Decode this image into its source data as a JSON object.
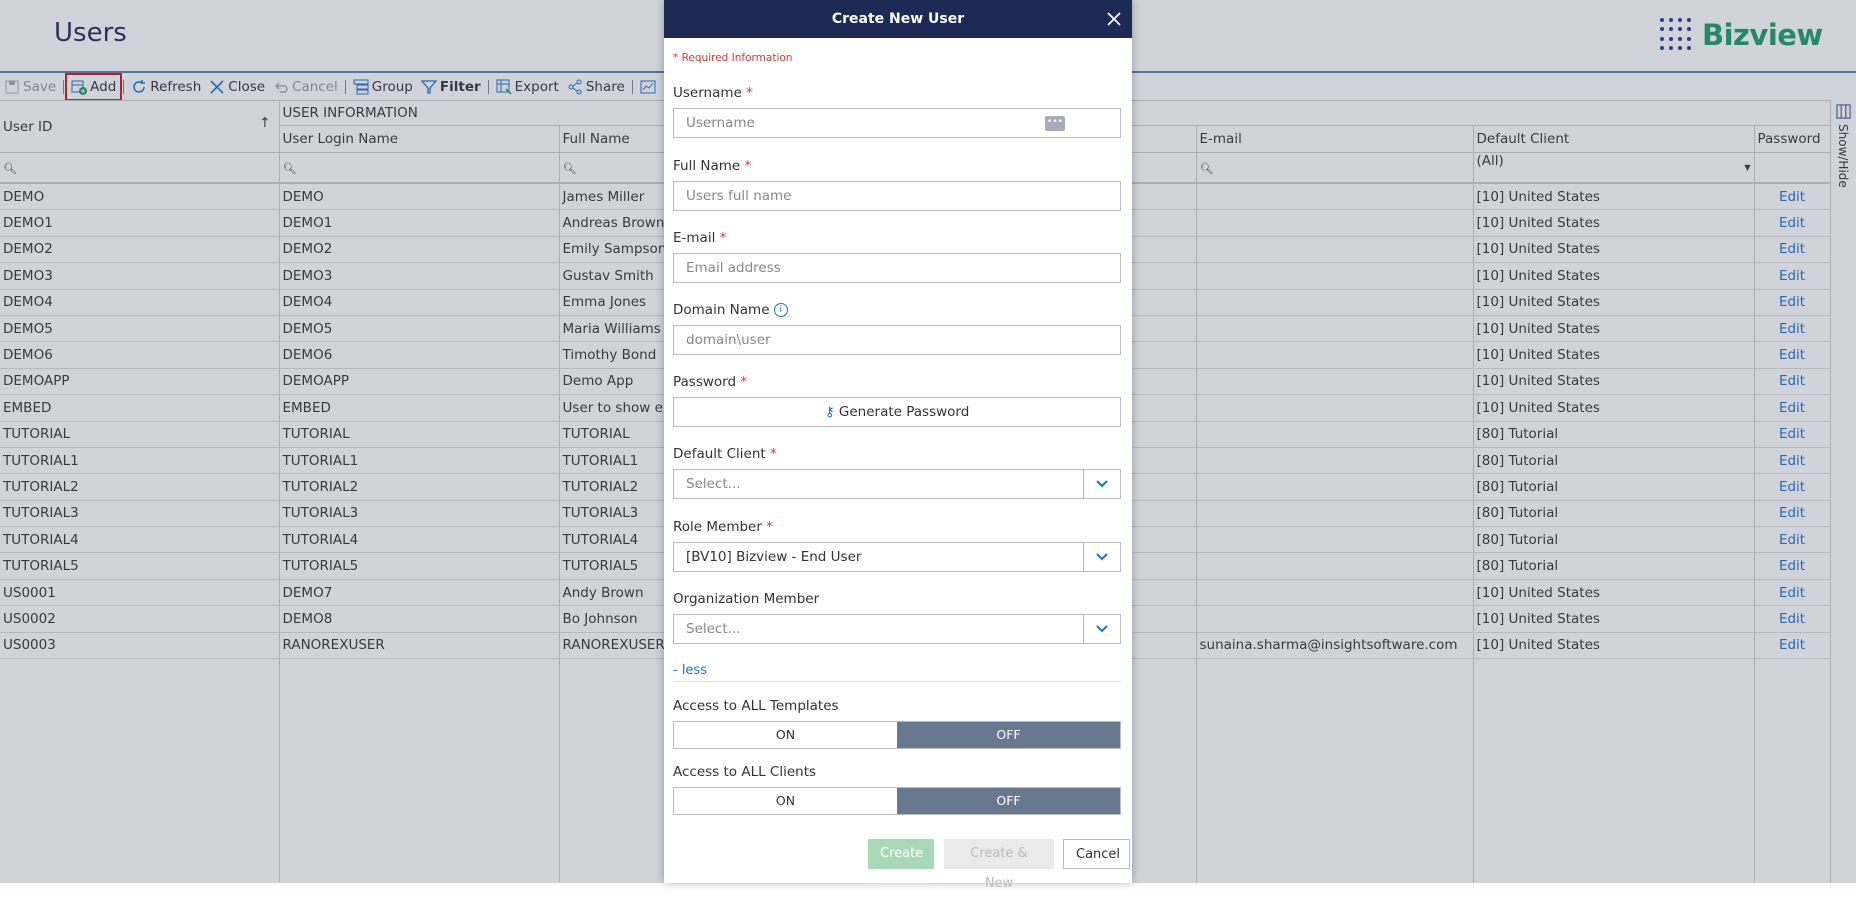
{
  "header": {
    "title": "Users",
    "logo_text": "Bizview"
  },
  "toolbar": {
    "save": "Save",
    "add": "Add",
    "refresh": "Refresh",
    "close": "Close",
    "cancel": "Cancel",
    "group": "Group",
    "filter": "Filter",
    "export": "Export",
    "share": "Share"
  },
  "grid": {
    "group_header": "USER INFORMATION",
    "columns": {
      "user_id": "User ID",
      "login": "User Login Name",
      "full_name": "Full Name",
      "email": "E-mail",
      "default_client": "Default Client",
      "password": "Password"
    },
    "filter_default_client": "(All)",
    "edit_label": "Edit",
    "rows": [
      {
        "id": "DEMO",
        "login": "DEMO",
        "name": "James Miller",
        "email": "",
        "client": "[10] United States"
      },
      {
        "id": "DEMO1",
        "login": "DEMO1",
        "name": "Andreas Brown",
        "email": "",
        "client": "[10] United States"
      },
      {
        "id": "DEMO2",
        "login": "DEMO2",
        "name": "Emily Sampson",
        "email": "",
        "client": "[10] United States"
      },
      {
        "id": "DEMO3",
        "login": "DEMO3",
        "name": "Gustav Smith",
        "email": "",
        "client": "[10] United States"
      },
      {
        "id": "DEMO4",
        "login": "DEMO4",
        "name": "Emma Jones",
        "email": "",
        "client": "[10] United States"
      },
      {
        "id": "DEMO5",
        "login": "DEMO5",
        "name": "Maria Williams",
        "email": "",
        "client": "[10] United States"
      },
      {
        "id": "DEMO6",
        "login": "DEMO6",
        "name": "Timothy Bond",
        "email": "",
        "client": "[10] United States"
      },
      {
        "id": "DEMOAPP",
        "login": "DEMOAPP",
        "name": "Demo App",
        "email": "",
        "client": "[10] United States"
      },
      {
        "id": "EMBED",
        "login": "EMBED",
        "name": "User to show en",
        "email": "",
        "client": "[10] United States"
      },
      {
        "id": "TUTORIAL",
        "login": "TUTORIAL",
        "name": "TUTORIAL",
        "email": "",
        "client": "[80] Tutorial"
      },
      {
        "id": "TUTORIAL1",
        "login": "TUTORIAL1",
        "name": "TUTORIAL1",
        "email": "",
        "client": "[80] Tutorial"
      },
      {
        "id": "TUTORIAL2",
        "login": "TUTORIAL2",
        "name": "TUTORIAL2",
        "email": "",
        "client": "[80] Tutorial"
      },
      {
        "id": "TUTORIAL3",
        "login": "TUTORIAL3",
        "name": "TUTORIAL3",
        "email": "",
        "client": "[80] Tutorial"
      },
      {
        "id": "TUTORIAL4",
        "login": "TUTORIAL4",
        "name": "TUTORIAL4",
        "email": "",
        "client": "[80] Tutorial"
      },
      {
        "id": "TUTORIAL5",
        "login": "TUTORIAL5",
        "name": "TUTORIAL5",
        "email": "",
        "client": "[80] Tutorial"
      },
      {
        "id": "US0001",
        "login": "DEMO7",
        "name": "Andy Brown",
        "email": "",
        "client": "[10] United States"
      },
      {
        "id": "US0002",
        "login": "DEMO8",
        "name": "Bo Johnson",
        "email": "",
        "client": "[10] United States"
      },
      {
        "id": "US0003",
        "login": "RANOREXUSER",
        "name": "RANOREXUSER",
        "email": "sunaina.sharma@insightsoftware.com",
        "client": "[10] United States"
      }
    ]
  },
  "showhide_label": "Show/Hide",
  "modal": {
    "title": "Create New User",
    "required_info": "* Required Information",
    "username_label": "Username",
    "username_placeholder": "Username",
    "fullname_label": "Full Name",
    "fullname_placeholder": "Users full name",
    "email_label": "E-mail",
    "email_placeholder": "Email address",
    "domain_label": "Domain Name",
    "domain_placeholder": "domain\\user",
    "password_label": "Password",
    "generate_password": "Generate Password",
    "default_client_label": "Default Client",
    "default_client_value": "Select...",
    "role_label": "Role Member",
    "role_value": "[BV10] Bizview - End User",
    "org_label": "Organization Member",
    "org_value": "Select...",
    "less_link": "- less",
    "templates_label": "Access to ALL Templates",
    "clients_label": "Access to ALL Clients",
    "on_label": "ON",
    "off_label": "OFF",
    "required_mark": "*",
    "create": "Create",
    "create_new": "Create & New",
    "cancel": "Cancel"
  },
  "colors": {
    "header_navy": "#1d2a55",
    "brand_green": "#1b9b63",
    "link_blue": "#1a73c9",
    "required_red": "#d33"
  }
}
